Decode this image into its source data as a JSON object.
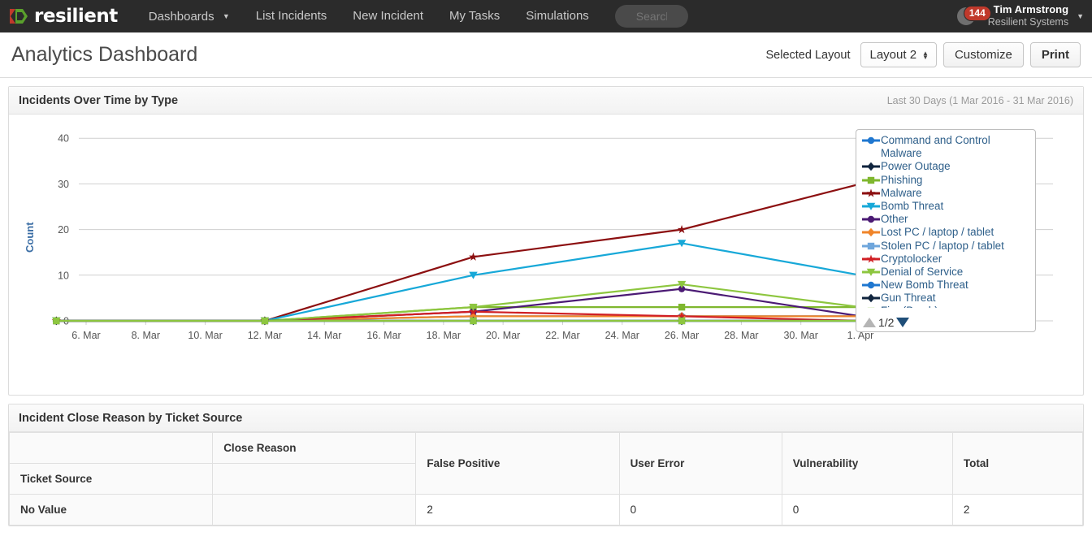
{
  "navbar": {
    "brand": "resilient",
    "items": [
      {
        "label": "Dashboards",
        "has_caret": true
      },
      {
        "label": "List Incidents",
        "has_caret": false
      },
      {
        "label": "New Incident",
        "has_caret": false
      },
      {
        "label": "My Tasks",
        "has_caret": false
      },
      {
        "label": "Simulations",
        "has_caret": false
      }
    ],
    "search_placeholder": "Search",
    "notification_count": "144",
    "user_name": "Tim Armstrong",
    "user_org": "Resilient Systems",
    "colors": {
      "bar": "#2b2b2b",
      "badge": "#c0392b",
      "logo_green": "#5aa02c",
      "logo_red": "#c0392b"
    }
  },
  "page": {
    "title": "Analytics Dashboard",
    "selected_layout_label": "Selected Layout",
    "layout_value": "Layout 2",
    "customize_label": "Customize",
    "print_label": "Print"
  },
  "chart_panel": {
    "title": "Incidents Over Time by Type",
    "meta": "Last 30 Days (1 Mar 2016 - 31 Mar 2016)",
    "legend_page": "1/2"
  },
  "chart_data": {
    "type": "line",
    "title": "Incidents Over Time by Type",
    "xlabel": "",
    "ylabel": "Count",
    "ylim": [
      0,
      42
    ],
    "yticks": [
      0,
      10,
      20,
      30,
      40
    ],
    "grid": true,
    "legend_position": "right",
    "xtick_labels": [
      "6. Mar",
      "8. Mar",
      "10. Mar",
      "12. Mar",
      "14. Mar",
      "16. Mar",
      "18. Mar",
      "20. Mar",
      "22. Mar",
      "24. Mar",
      "26. Mar",
      "28. Mar",
      "30. Mar",
      "1. Apr"
    ],
    "x": [
      "4. Mar",
      "12. Mar",
      "19. Mar",
      "26. Mar",
      "1. Apr"
    ],
    "series": [
      {
        "name": "Command and Control Malware",
        "color": "#1f77d0",
        "marker": "circle",
        "values": [
          0,
          0,
          1,
          1,
          1
        ]
      },
      {
        "name": "Power Outage",
        "color": "#10243e",
        "marker": "diamond",
        "values": [
          0,
          0,
          0,
          0,
          0
        ]
      },
      {
        "name": "Phishing",
        "color": "#7fb72e",
        "marker": "square",
        "values": [
          0,
          0,
          3,
          3,
          3
        ]
      },
      {
        "name": "Malware",
        "color": "#8c0f10",
        "marker": "star",
        "values": [
          0,
          0,
          14,
          20,
          30
        ]
      },
      {
        "name": "Bomb Threat",
        "color": "#17a8d8",
        "marker": "triangle-down",
        "values": [
          0,
          0,
          10,
          17,
          10
        ]
      },
      {
        "name": "Other",
        "color": "#4b1a74",
        "marker": "circle",
        "values": [
          0,
          0,
          2,
          7,
          1
        ]
      },
      {
        "name": "Lost PC / laptop / tablet",
        "color": "#f0852a",
        "marker": "diamond",
        "values": [
          0,
          0,
          1,
          1,
          1
        ]
      },
      {
        "name": "Stolen PC / laptop / tablet",
        "color": "#6fa6dc",
        "marker": "square",
        "values": [
          0,
          0,
          0,
          0,
          0
        ]
      },
      {
        "name": "Cryptolocker",
        "color": "#d01f24",
        "marker": "star",
        "values": [
          0,
          0,
          2,
          1,
          0
        ]
      },
      {
        "name": "Denial of Service",
        "color": "#8dc63f",
        "marker": "triangle-down",
        "values": [
          0,
          0,
          3,
          8,
          3
        ]
      },
      {
        "name": "New Bomb Threat",
        "color": "#1f77d0",
        "marker": "circle",
        "values": [
          0,
          0,
          0,
          0,
          0
        ]
      },
      {
        "name": "Gun Threat",
        "color": "#10243e",
        "marker": "diamond",
        "values": [
          0,
          0,
          0,
          0,
          0
        ]
      },
      {
        "name": "Fire (Brush)",
        "color": "#8dc63f",
        "marker": "square",
        "values": [
          0,
          0,
          0,
          0,
          0
        ]
      }
    ]
  },
  "table_panel": {
    "title": "Incident Close Reason by Ticket Source",
    "corner_top_label": "Close Reason",
    "corner_bottom_label": "Ticket Source",
    "columns": [
      "False Positive",
      "User Error",
      "Vulnerability",
      "Total"
    ],
    "rows": [
      {
        "label": "No Value",
        "values": [
          "2",
          "0",
          "0",
          "2"
        ]
      }
    ]
  }
}
